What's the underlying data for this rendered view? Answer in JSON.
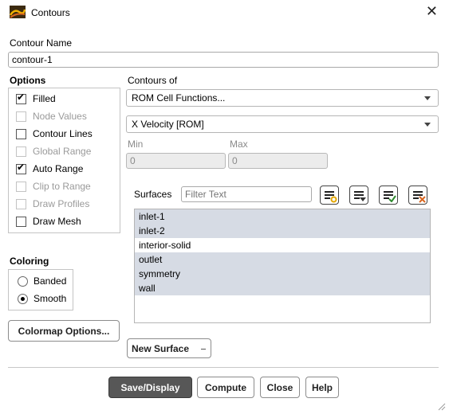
{
  "window": {
    "title": "Contours"
  },
  "contour_name": {
    "label": "Contour Name",
    "value": "contour-1"
  },
  "options": {
    "heading": "Options",
    "items": [
      {
        "label": "Filled",
        "checked": true,
        "enabled": true
      },
      {
        "label": "Node Values",
        "checked": false,
        "enabled": false
      },
      {
        "label": "Contour Lines",
        "checked": false,
        "enabled": true
      },
      {
        "label": "Global Range",
        "checked": false,
        "enabled": false
      },
      {
        "label": "Auto Range",
        "checked": true,
        "enabled": true
      },
      {
        "label": "Clip to Range",
        "checked": false,
        "enabled": false
      },
      {
        "label": "Draw Profiles",
        "checked": false,
        "enabled": false
      },
      {
        "label": "Draw Mesh",
        "checked": false,
        "enabled": true
      }
    ]
  },
  "contours_of": {
    "label": "Contours of",
    "category": "ROM Cell Functions...",
    "variable": "X Velocity [ROM]"
  },
  "range": {
    "min_label": "Min",
    "min_value": "0",
    "max_label": "Max",
    "max_value": "0"
  },
  "coloring": {
    "heading": "Coloring",
    "options": [
      {
        "label": "Banded",
        "selected": false
      },
      {
        "label": "Smooth",
        "selected": true
      }
    ]
  },
  "surfaces": {
    "label": "Surfaces",
    "filter_placeholder": "Filter Text",
    "items": [
      {
        "label": "inlet-1",
        "selected": true
      },
      {
        "label": "inlet-2",
        "selected": true
      },
      {
        "label": "interior-solid",
        "selected": false
      },
      {
        "label": "outlet",
        "selected": true
      },
      {
        "label": "symmetry",
        "selected": true
      },
      {
        "label": "wall",
        "selected": true
      }
    ]
  },
  "buttons": {
    "colormap": "Colormap Options...",
    "new_surface": "New Surface",
    "save_display": "Save/Display",
    "compute": "Compute",
    "close": "Close",
    "help": "Help"
  },
  "icons": {
    "window": "contours-app-icon",
    "close": "close-icon",
    "surface_tools": [
      "select-all-icon",
      "filter-menu-icon",
      "select-checked-icon",
      "deselect-all-icon"
    ]
  },
  "colors": {
    "selection": "#d6dbe4",
    "primary_button": "#575757",
    "accent_yellow": "#e3a600",
    "accent_green": "#2e8a2e",
    "accent_orange": "#d9661f"
  }
}
